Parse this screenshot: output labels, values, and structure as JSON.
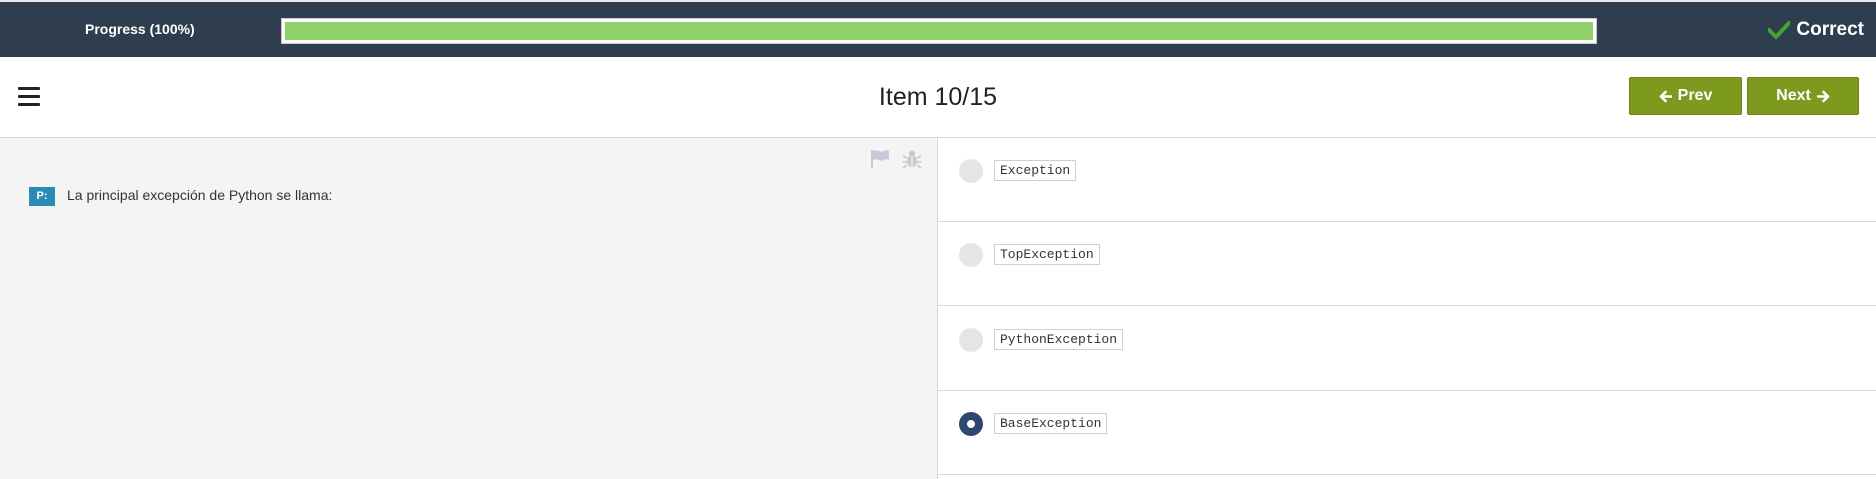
{
  "progress": {
    "label": "Progress (100%)",
    "value": 1.0,
    "fill_color": "#8fd16b"
  },
  "status": {
    "text": "Correct",
    "icon": "checkmark-icon",
    "icon_color": "#3fa535"
  },
  "header": {
    "menu_icon": "hamburger-menu-icon",
    "title": "Item 10/15",
    "prev_label": "Prev",
    "next_label": "Next",
    "button_color": "#7e9a1e"
  },
  "question": {
    "badge": "P:",
    "text": "La principal excepción de Python se llama:",
    "tools": [
      "flag-icon",
      "bug-icon"
    ]
  },
  "options": [
    {
      "text": "Exception",
      "selected": false
    },
    {
      "text": "TopException",
      "selected": false
    },
    {
      "text": "PythonException",
      "selected": false
    },
    {
      "text": "BaseException",
      "selected": true
    }
  ]
}
